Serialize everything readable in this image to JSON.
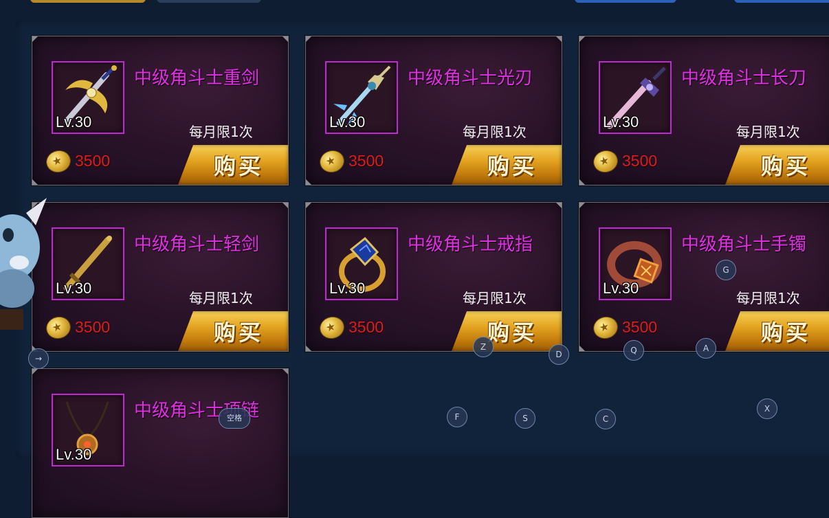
{
  "products": [
    {
      "name": "中级角斗士重剑",
      "level": "Lv.30",
      "limit": "每月限1次",
      "price": "3500",
      "buy": "购买",
      "icon": "heavy-sword-icon"
    },
    {
      "name": "中级角斗士光刃",
      "level": "Lv.30",
      "limit": "每月限1次",
      "price": "3500",
      "buy": "购买",
      "icon": "light-blade-icon"
    },
    {
      "name": "中级角斗士长刀",
      "level": "Lv.30",
      "limit": "每月限1次",
      "price": "3500",
      "buy": "购买",
      "icon": "long-saber-icon"
    },
    {
      "name": "中级角斗士轻剑",
      "level": "Lv.30",
      "limit": "每月限1次",
      "price": "3500",
      "buy": "购买",
      "icon": "light-sword-icon"
    },
    {
      "name": "中级角斗士戒指",
      "level": "Lv.30",
      "limit": "每月限1次",
      "price": "3500",
      "buy": "购买",
      "icon": "ring-icon"
    },
    {
      "name": "中级角斗士手镯",
      "level": "Lv.30",
      "limit": "每月限1次",
      "price": "3500",
      "buy": "购买",
      "icon": "bracelet-icon"
    },
    {
      "name": "中级角斗士项链",
      "level": "Lv.30",
      "icon": "necklace-icon"
    }
  ],
  "key_hints": {
    "arrow": "→",
    "g": "G",
    "z": "Z",
    "d": "D",
    "q": "Q",
    "a": "A",
    "space": "空格",
    "f": "F",
    "s": "S",
    "c": "C",
    "x": "X"
  },
  "colors": {
    "name": "#e32ee6",
    "price": "#d81f1f",
    "frame": "#c227d6",
    "buy": "#e3a320"
  }
}
